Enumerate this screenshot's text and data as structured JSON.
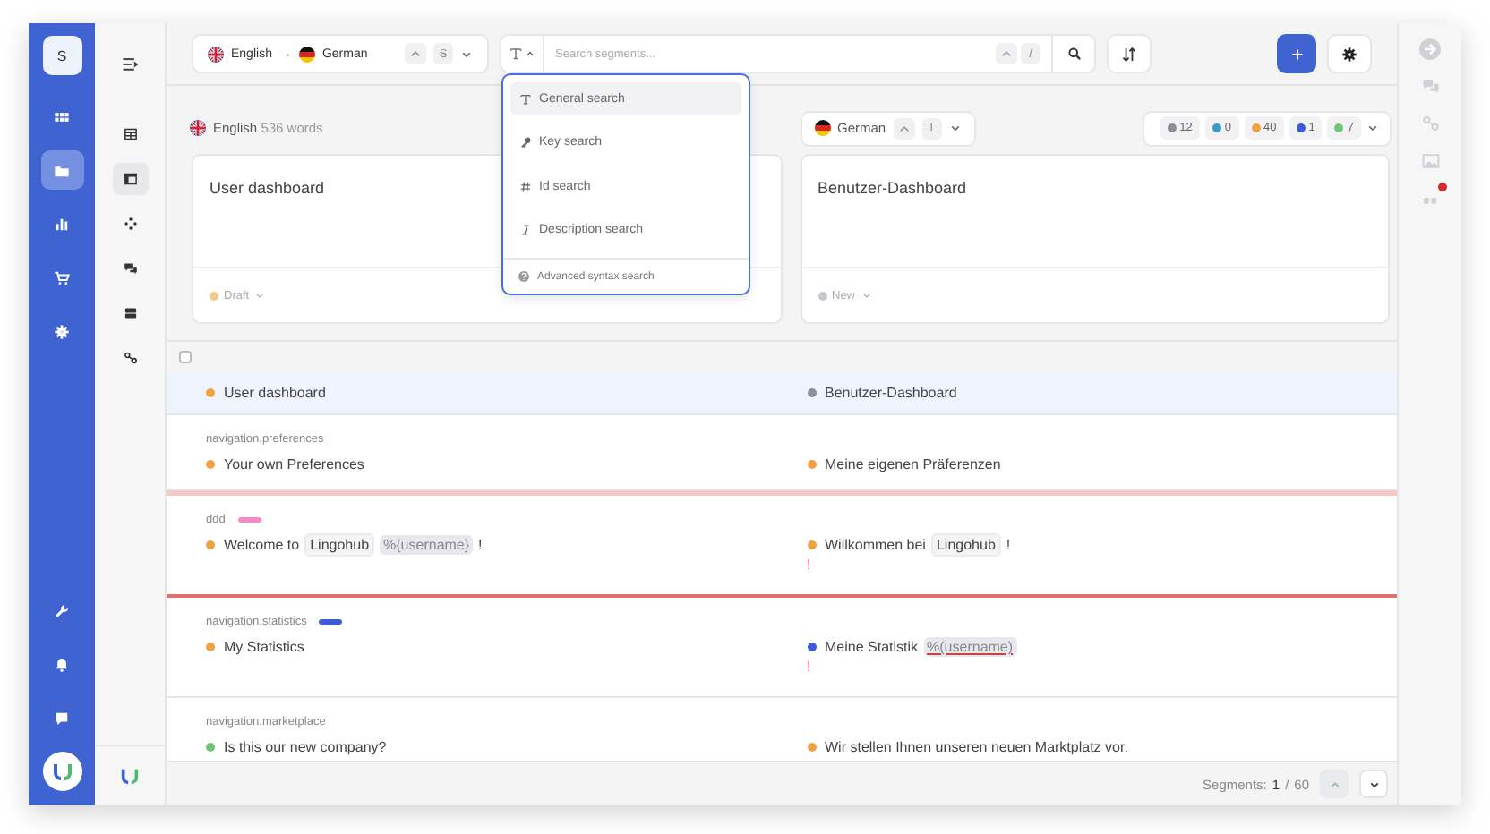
{
  "rail": {
    "avatar": "S",
    "items": [
      {
        "selected": false
      },
      {
        "selected": true
      },
      {
        "selected": false
      },
      {
        "selected": false
      },
      {
        "selected": false
      }
    ]
  },
  "sidebar": {
    "items": [
      {
        "selected": false
      },
      {
        "selected": true
      },
      {
        "selected": false
      },
      {
        "selected": false
      },
      {
        "selected": false
      },
      {
        "selected": false
      }
    ]
  },
  "toolbar": {
    "source_language": "English",
    "arrow": "→",
    "target_language": "German",
    "shortcut": "S",
    "search_placeholder": "Search segments...",
    "search_shortcut": "/"
  },
  "search_menu": {
    "items": [
      {
        "kind": "general",
        "label": "General search",
        "selected": true
      },
      {
        "kind": "key",
        "label": "Key search",
        "selected": false
      },
      {
        "kind": "id",
        "label": "Id search",
        "selected": false
      },
      {
        "kind": "description",
        "label": "Description search",
        "selected": false
      }
    ],
    "footer": "Advanced syntax search"
  },
  "source": {
    "language": "English",
    "word_count": "536 words",
    "card_text": "User dashboard",
    "status": {
      "label": "Draft",
      "color": "#f5c88e"
    }
  },
  "target": {
    "language": "German",
    "shortcut": "T",
    "card_text": "Benutzer-Dashboard",
    "status": {
      "label": "New",
      "color": "#c4c7cc"
    }
  },
  "status_counts": [
    {
      "count": "12",
      "color": "#8a8f99"
    },
    {
      "count": "0",
      "color": "#3d9bc9"
    },
    {
      "count": "40",
      "color": "#f0a144"
    },
    {
      "count": "1",
      "color": "#3b5bdb"
    },
    {
      "count": "7",
      "color": "#6cc674"
    }
  ],
  "select_all": {
    "checked": false
  },
  "segments": [
    {
      "selected": true,
      "error": false,
      "source": {
        "color": "#f0a144",
        "parts": [
          {
            "kind": "text",
            "text": "User dashboard"
          }
        ]
      },
      "target": {
        "color": "#8a8f99",
        "parts": [
          {
            "kind": "text",
            "text": "Benutzer-Dashboard"
          }
        ]
      }
    },
    {
      "key": "navigation.preferences",
      "selected": false,
      "error": false,
      "source": {
        "color": "#f0a144",
        "parts": [
          {
            "kind": "text",
            "text": "Your own Preferences"
          }
        ]
      },
      "target": {
        "color": "#f0a144",
        "parts": [
          {
            "kind": "text",
            "text": "Meine eigenen Präferenzen"
          }
        ]
      }
    },
    {
      "key": "ddd",
      "tag": {
        "color": "#f28cc4"
      },
      "selected": false,
      "error": true,
      "source": {
        "color": "#f0a144",
        "parts": [
          {
            "kind": "text",
            "text": "Welcome to"
          },
          {
            "kind": "tag",
            "text": "Lingohub"
          },
          {
            "kind": "placeholder",
            "text": "%{username}"
          },
          {
            "kind": "text",
            "text": "!"
          }
        ]
      },
      "target": {
        "color": "#f0a144",
        "parts": [
          {
            "kind": "text",
            "text": "Willkommen bei"
          },
          {
            "kind": "tag",
            "text": "Lingohub"
          },
          {
            "kind": "text",
            "text": "!"
          }
        ],
        "warning": "!"
      }
    },
    {
      "key": "navigation.statistics",
      "tag": {
        "color": "#3b5bdb"
      },
      "selected": false,
      "error": false,
      "source": {
        "color": "#f0a144",
        "parts": [
          {
            "kind": "text",
            "text": "My Statistics"
          }
        ]
      },
      "target": {
        "color": "#3b5bdb",
        "parts": [
          {
            "kind": "text",
            "text": "Meine Statistik"
          },
          {
            "kind": "invalid",
            "text": "%(username)"
          }
        ],
        "warning": "!"
      }
    },
    {
      "key": "navigation.marketplace",
      "selected": false,
      "error": false,
      "source": {
        "color": "#6cc674",
        "parts": [
          {
            "kind": "text",
            "text": "Is this our new company?"
          }
        ]
      },
      "target": {
        "color": "#f0a144",
        "parts": [
          {
            "kind": "text",
            "text": "Wir stellen Ihnen unseren neuen Marktplatz vor."
          }
        ]
      }
    }
  ],
  "footer": {
    "label": "Segments:",
    "current": "1",
    "separator": "/",
    "total": "60"
  },
  "right_rail": {
    "items": [
      {
        "alert": false
      },
      {
        "alert": false
      },
      {
        "alert": false
      },
      {
        "alert": false
      },
      {
        "alert": true
      }
    ]
  }
}
